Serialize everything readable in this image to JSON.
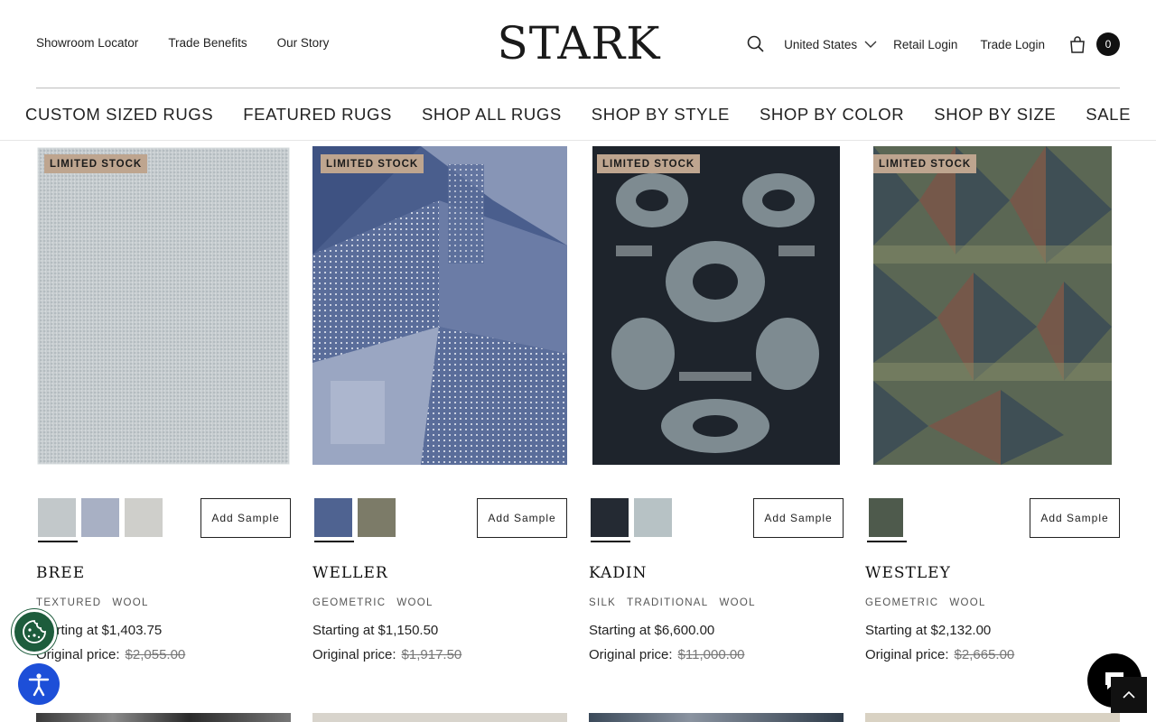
{
  "header": {
    "utility_links": [
      "Showroom Locator",
      "Trade Benefits",
      "Our Story"
    ],
    "logo": "STARK",
    "country": "United States",
    "retail_login": "Retail Login",
    "trade_login": "Trade Login",
    "cart_count": "0"
  },
  "nav": [
    "CUSTOM SIZED RUGS",
    "FEATURED RUGS",
    "SHOP ALL RUGS",
    "SHOP BY STYLE",
    "SHOP BY COLOR",
    "SHOP BY SIZE",
    "SALE"
  ],
  "products": [
    {
      "badge": "LIMITED STOCK",
      "name": "BREE",
      "tags": [
        "TEXTURED",
        "WOOL"
      ],
      "price": "Starting at $1,403.75",
      "original_label": "Original price:",
      "original_price": "$2,055.00",
      "add_sample": "Add Sample",
      "swatch_colors": [
        "#c2c8ca",
        "#a8b0c4",
        "#cfcfcb"
      ]
    },
    {
      "badge": "LIMITED STOCK",
      "name": "WELLER",
      "tags": [
        "GEOMETRIC",
        "WOOL"
      ],
      "price": "Starting at $1,150.50",
      "original_label": "Original price:",
      "original_price": "$1,917.50",
      "add_sample": "Add Sample",
      "swatch_colors": [
        "#4f6391",
        "#7c7b68"
      ]
    },
    {
      "badge": "LIMITED STOCK",
      "name": "KADIN",
      "tags": [
        "SILK",
        "TRADITIONAL",
        "WOOL"
      ],
      "price": "Starting at $6,600.00",
      "original_label": "Original price:",
      "original_price": "$11,000.00",
      "add_sample": "Add Sample",
      "swatch_colors": [
        "#242a33",
        "#b7c2c5"
      ]
    },
    {
      "badge": "LIMITED STOCK",
      "name": "WESTLEY",
      "tags": [
        "GEOMETRIC",
        "WOOL"
      ],
      "price": "Starting at $2,132.00",
      "original_label": "Original price:",
      "original_price": "$2,665.00",
      "add_sample": "Add Sample",
      "swatch_colors": [
        "#4e5a4c"
      ]
    }
  ],
  "colors": {
    "badge_bg": "#bea58f",
    "cookie_green": "#1d5c3c",
    "accessibility_blue": "#1d4fd8"
  },
  "icons": {
    "search": "search-icon",
    "chevron": "chevron-down-icon",
    "bag": "shopping-bag-icon",
    "cookie": "cookie-icon",
    "accessibility": "accessibility-icon",
    "chat": "chat-icon"
  }
}
